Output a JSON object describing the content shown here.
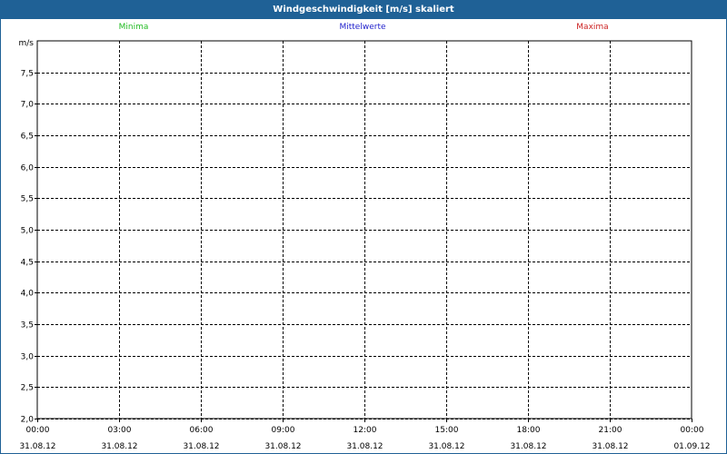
{
  "window": {
    "title": "Windgeschwindigkeit [m/s] skaliert"
  },
  "chart_data": {
    "type": "line",
    "title": "Windgeschwindigkeit [m/s] skaliert",
    "ylabel": "m/s",
    "ylim": [
      2.0,
      8.0
    ],
    "yticks": [
      "7,5",
      "7,0",
      "6,5",
      "6,0",
      "5,5",
      "5,0",
      "4,5",
      "4,0",
      "3,5",
      "3,0",
      "2,5",
      "2,0"
    ],
    "ytick_values": [
      7.5,
      7.0,
      6.5,
      6.0,
      5.5,
      5.0,
      4.5,
      4.0,
      3.5,
      3.0,
      2.5,
      2.0
    ],
    "xticks": [
      {
        "time": "00:00",
        "date": "31.08.12"
      },
      {
        "time": "03:00",
        "date": "31.08.12"
      },
      {
        "time": "06:00",
        "date": "31.08.12"
      },
      {
        "time": "09:00",
        "date": "31.08.12"
      },
      {
        "time": "12:00",
        "date": "31.08.12"
      },
      {
        "time": "15:00",
        "date": "31.08.12"
      },
      {
        "time": "18:00",
        "date": "31.08.12"
      },
      {
        "time": "21:00",
        "date": "31.08.12"
      },
      {
        "time": "00:00",
        "date": "01.09.12"
      }
    ],
    "grid": true,
    "legend_position": "top",
    "series": [
      {
        "name": "Minima",
        "color": "#22bb22",
        "values": []
      },
      {
        "name": "Mittelwerte",
        "color": "#2222cc",
        "values": []
      },
      {
        "name": "Maxima",
        "color": "#cc2222",
        "values": []
      }
    ]
  }
}
